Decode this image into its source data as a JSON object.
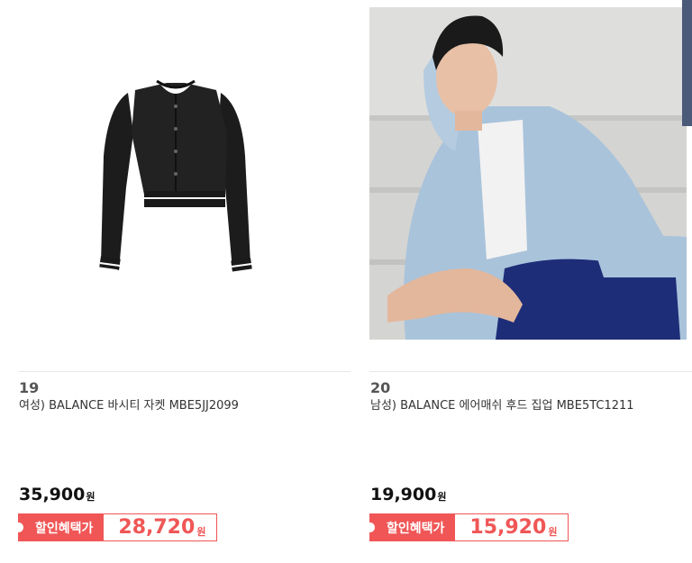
{
  "products": [
    {
      "rank": "19",
      "title": "여성) BALANCE 바시티 자켓 MBE5JJ2099",
      "price": "35,900",
      "price_unit": "원",
      "benefit_label": "할인혜택가",
      "sale_price": "28,720",
      "sale_unit": "원",
      "image_icon": "black-varsity-jacket"
    },
    {
      "rank": "20",
      "title": "남성) BALANCE 에어매쉬 후드 집업 MBE5TC1211",
      "price": "19,900",
      "price_unit": "원",
      "benefit_label": "할인혜택가",
      "sale_price": "15,920",
      "sale_unit": "원",
      "image_icon": "model-wearing-blue-hood-zipup"
    }
  ],
  "colors": {
    "accent": "#f05656",
    "price_text": "#111111",
    "rank_text": "#555555"
  }
}
